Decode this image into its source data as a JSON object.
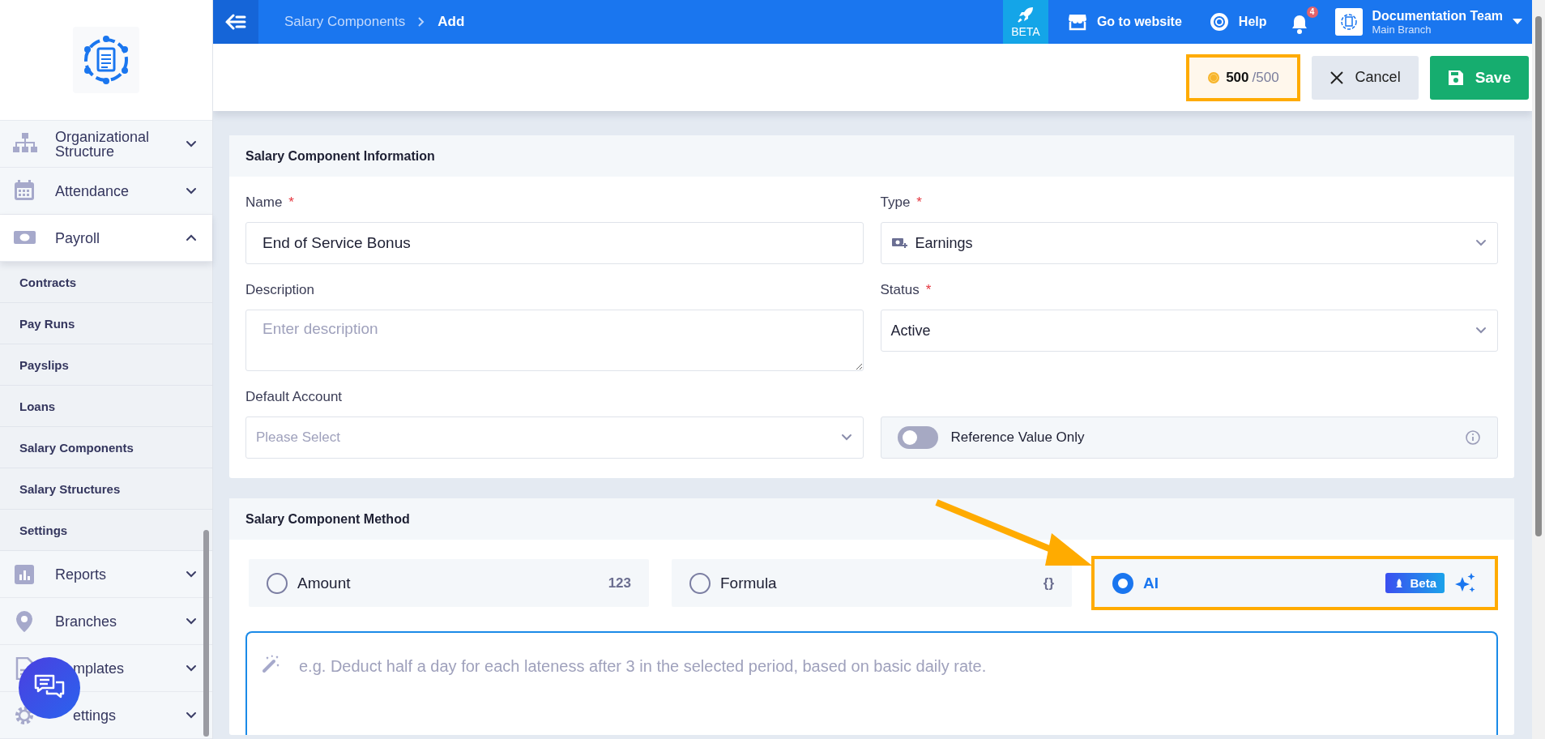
{
  "sidebar": {
    "items": [
      {
        "label": "Organizational Structure",
        "expanded": false
      },
      {
        "label": "Attendance",
        "expanded": false
      },
      {
        "label": "Payroll",
        "expanded": true,
        "children": [
          {
            "label": "Contracts"
          },
          {
            "label": "Pay Runs"
          },
          {
            "label": "Payslips"
          },
          {
            "label": "Loans"
          },
          {
            "label": "Salary Components"
          },
          {
            "label": "Salary Structures"
          },
          {
            "label": "Settings"
          }
        ]
      },
      {
        "label": "Reports",
        "expanded": false
      },
      {
        "label": "Branches",
        "expanded": false
      },
      {
        "label": "mplates",
        "expanded": false
      },
      {
        "label": "ettings",
        "expanded": false
      }
    ]
  },
  "topbar": {
    "breadcrumb": [
      "Salary Components",
      "Add"
    ],
    "beta": "BETA",
    "website": "Go to website",
    "help": "Help",
    "notifications": "4",
    "user": {
      "name": "Documentation Team",
      "branch": "Main Branch"
    }
  },
  "toolbar": {
    "credits": {
      "used": "500",
      "total": "/500",
      "highlighted": true
    },
    "cancel": "Cancel",
    "save": "Save"
  },
  "info": {
    "title": "Salary Component Information",
    "fields": [
      {
        "kind": "text",
        "label": "Name",
        "required_mark": "*",
        "value": "End of Service Bonus"
      },
      {
        "kind": "iconselect",
        "label": "Type",
        "required_mark": "*",
        "value": "Earnings"
      },
      {
        "kind": "textarea",
        "label": "Description",
        "placeholder": "Enter description"
      },
      {
        "kind": "select",
        "label": "Status",
        "required_mark": "*",
        "value": "Active"
      },
      {
        "kind": "select",
        "label": "Default Account",
        "placeholder": "Please Select"
      },
      {
        "kind": "toggle",
        "label": "Reference Value Only",
        "on": false
      }
    ]
  },
  "method": {
    "title": "Salary Component Method",
    "options": [
      {
        "kind": "tag",
        "label": "Amount",
        "selected": false,
        "tag": "123",
        "highlighted": false
      },
      {
        "kind": "tag",
        "label": "Formula",
        "selected": false,
        "tag": "{}",
        "highlighted": false
      },
      {
        "kind": "ai",
        "label": "AI",
        "selected": true,
        "badge": "Beta",
        "highlighted": true
      }
    ],
    "prompt": {
      "placeholder": "e.g. Deduct half a day for each lateness after 3 in the selected period, based on basic daily rate."
    }
  }
}
